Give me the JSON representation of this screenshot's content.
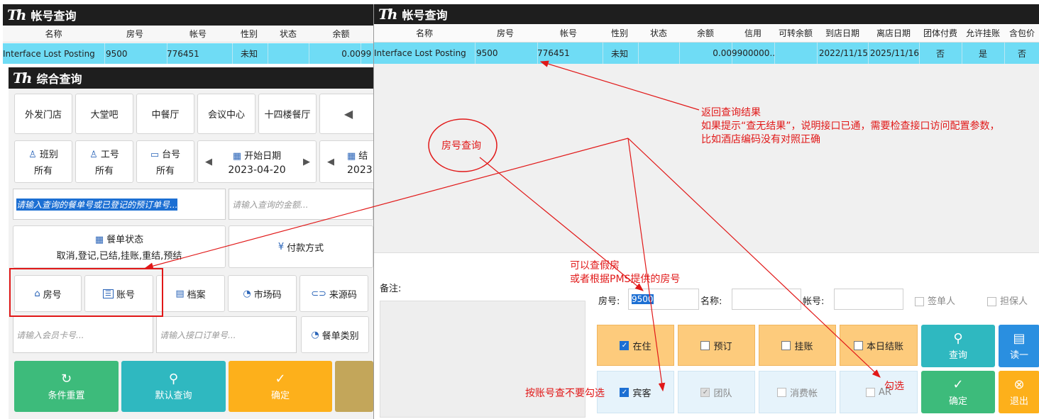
{
  "left_window": {
    "title": "帐号查询",
    "columns": [
      "名称",
      "房号",
      "帐号",
      "性别",
      "状态",
      "余额"
    ],
    "row": {
      "name": "Interface Lost Posting",
      "room": "9500",
      "account": "776451",
      "gender": "未知",
      "status": "",
      "balance": "0.00",
      "cut": "99"
    }
  },
  "combo_window": {
    "title": "综合查询",
    "outlets": [
      "外发门店",
      "大堂吧",
      "中餐厅",
      "会议中心",
      "十四楼餐厅"
    ],
    "filters": [
      {
        "label": "班别",
        "value": "所有"
      },
      {
        "label": "工号",
        "value": "所有"
      },
      {
        "label": "台号",
        "value": "所有"
      }
    ],
    "start_date": {
      "label": "开始日期",
      "value": "2023-04-20"
    },
    "end_date": {
      "label": "结",
      "value": "2023"
    },
    "order_input_placeholder": "请输入查询的餐单号或已登记的预订单号...",
    "amount_input_placeholder": "请输入查询的金额...",
    "order_status": {
      "label": "餐单状态",
      "value": "取消,登记,已结,挂账,重结,预结"
    },
    "payment_label": "付款方式",
    "search_types": [
      "房号",
      "账号",
      "档案",
      "市场码",
      "来源码"
    ],
    "member_placeholder": "请输入会员卡号...",
    "iface_placeholder": "请输入接口订单号...",
    "order_category": "餐单类别",
    "actions": [
      "条件重置",
      "默认查询",
      "确定"
    ]
  },
  "right_window": {
    "title": "帐号查询",
    "columns": [
      "名称",
      "房号",
      "帐号",
      "性别",
      "状态",
      "余额",
      "信用",
      "可转余额",
      "到店日期",
      "离店日期",
      "团体付费",
      "允许挂账",
      "含包价"
    ],
    "row": [
      "Interface Lost Posting",
      "9500",
      "776451",
      "未知",
      "",
      "0.00",
      "9900000...",
      "",
      "2022/11/15",
      "2025/11/16",
      "否",
      "是",
      "否"
    ],
    "remark_label": "备注:",
    "room_label": "房号:",
    "room_value": "9500",
    "name_label": "名称:",
    "account_label": "帐号:",
    "signer_label": "签单人",
    "guarantor_label": "担保人",
    "opts_row1": [
      "在住",
      "预订",
      "挂账",
      "本日结账"
    ],
    "opts_row2": [
      "宾客",
      "团队",
      "消费帐",
      "AR"
    ],
    "query_btn": "查询",
    "read_btn": "读一",
    "confirm_btn": "确定",
    "exit_btn": "退出"
  },
  "annotations": {
    "result_line1": "返回查询结果",
    "result_line2": "如果提示“查无结果”，说明接口已通，需要检查接口访问配置参数，",
    "result_line3": "比如酒店编码没有对照正确",
    "room_query": "房号查询",
    "fake_room_line1": "可以查假房",
    "fake_room_line2": "或者根据PMS提供的房号",
    "no_check": "按账号查不要勾选",
    "check": "勾选"
  },
  "colors": {
    "annotation": "#e11818",
    "highlight_row": "#6fdcf5",
    "green": "#3dbb7b",
    "teal": "#2fb8c0",
    "orange": "#fdb01b",
    "blue": "#2a8fe0"
  }
}
